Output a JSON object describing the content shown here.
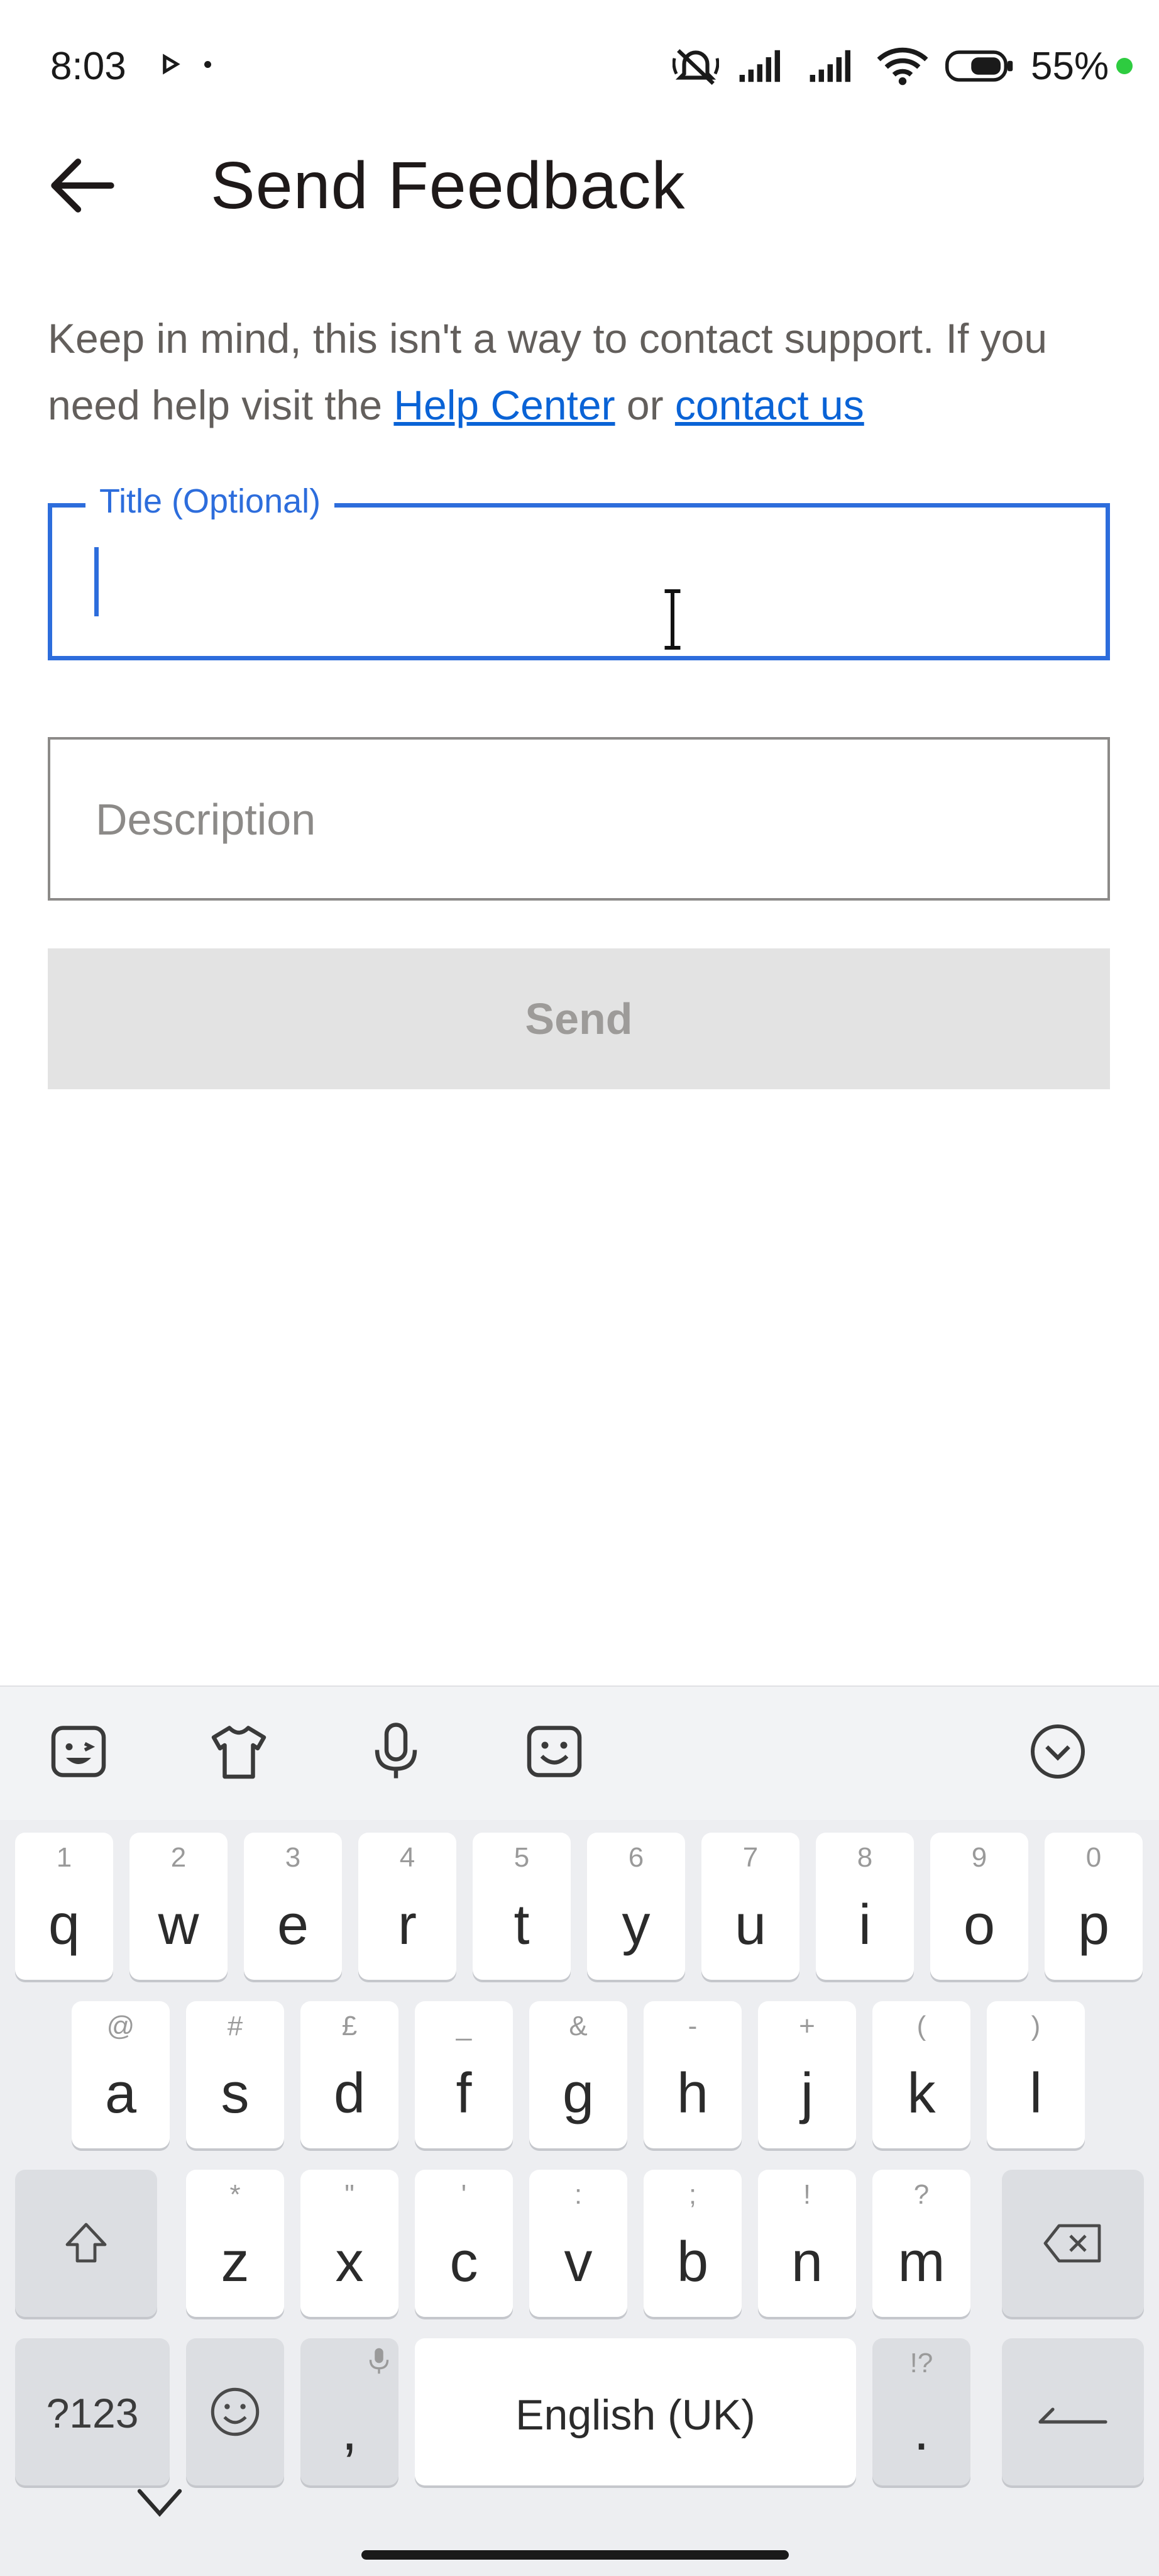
{
  "status_bar": {
    "time": "8:03",
    "battery_percent": "55%",
    "icons": [
      "play-icon",
      "silent-icon",
      "signal-icon",
      "signal-icon",
      "wifi-icon",
      "battery-icon"
    ]
  },
  "app_bar": {
    "title": "Send Feedback",
    "back_icon": "arrow-left-icon"
  },
  "notice": {
    "text_before": "Keep in mind, this isn't a way to contact support. If you need help visit the ",
    "link_help": "Help Center",
    "text_between": " or ",
    "link_contact": "contact us"
  },
  "form": {
    "title_label": "Title (Optional)",
    "title_value": "",
    "description_placeholder": "Description",
    "description_value": "",
    "send_label": "Send"
  },
  "colors": {
    "accent": "#2d6ddc",
    "link": "#0a63d6",
    "button_disabled_bg": "#e3e3e3",
    "keyboard_bg": "#edeef1"
  },
  "keyboard": {
    "toolbar_icons": [
      "sticker-icon",
      "theme-shirt-icon",
      "microphone-icon",
      "emoji-face-icon",
      "collapse-chevron-icon"
    ],
    "row1": [
      {
        "key": "q",
        "hint": "1"
      },
      {
        "key": "w",
        "hint": "2"
      },
      {
        "key": "e",
        "hint": "3"
      },
      {
        "key": "r",
        "hint": "4"
      },
      {
        "key": "t",
        "hint": "5"
      },
      {
        "key": "y",
        "hint": "6"
      },
      {
        "key": "u",
        "hint": "7"
      },
      {
        "key": "i",
        "hint": "8"
      },
      {
        "key": "o",
        "hint": "9"
      },
      {
        "key": "p",
        "hint": "0"
      }
    ],
    "row2": [
      {
        "key": "a",
        "hint": "@"
      },
      {
        "key": "s",
        "hint": "#"
      },
      {
        "key": "d",
        "hint": "£"
      },
      {
        "key": "f",
        "hint": "_"
      },
      {
        "key": "g",
        "hint": "&"
      },
      {
        "key": "h",
        "hint": "-"
      },
      {
        "key": "j",
        "hint": "+"
      },
      {
        "key": "k",
        "hint": "("
      },
      {
        "key": "l",
        "hint": ")"
      }
    ],
    "row3": [
      {
        "key": "z",
        "hint": "*"
      },
      {
        "key": "x",
        "hint": "\""
      },
      {
        "key": "c",
        "hint": "'"
      },
      {
        "key": "v",
        "hint": ":"
      },
      {
        "key": "b",
        "hint": ";"
      },
      {
        "key": "n",
        "hint": "!"
      },
      {
        "key": "m",
        "hint": "?"
      }
    ],
    "symbols_label": "?123",
    "comma": ",",
    "space_label": "English (UK)",
    "period": ".",
    "period_hint": "!?"
  }
}
